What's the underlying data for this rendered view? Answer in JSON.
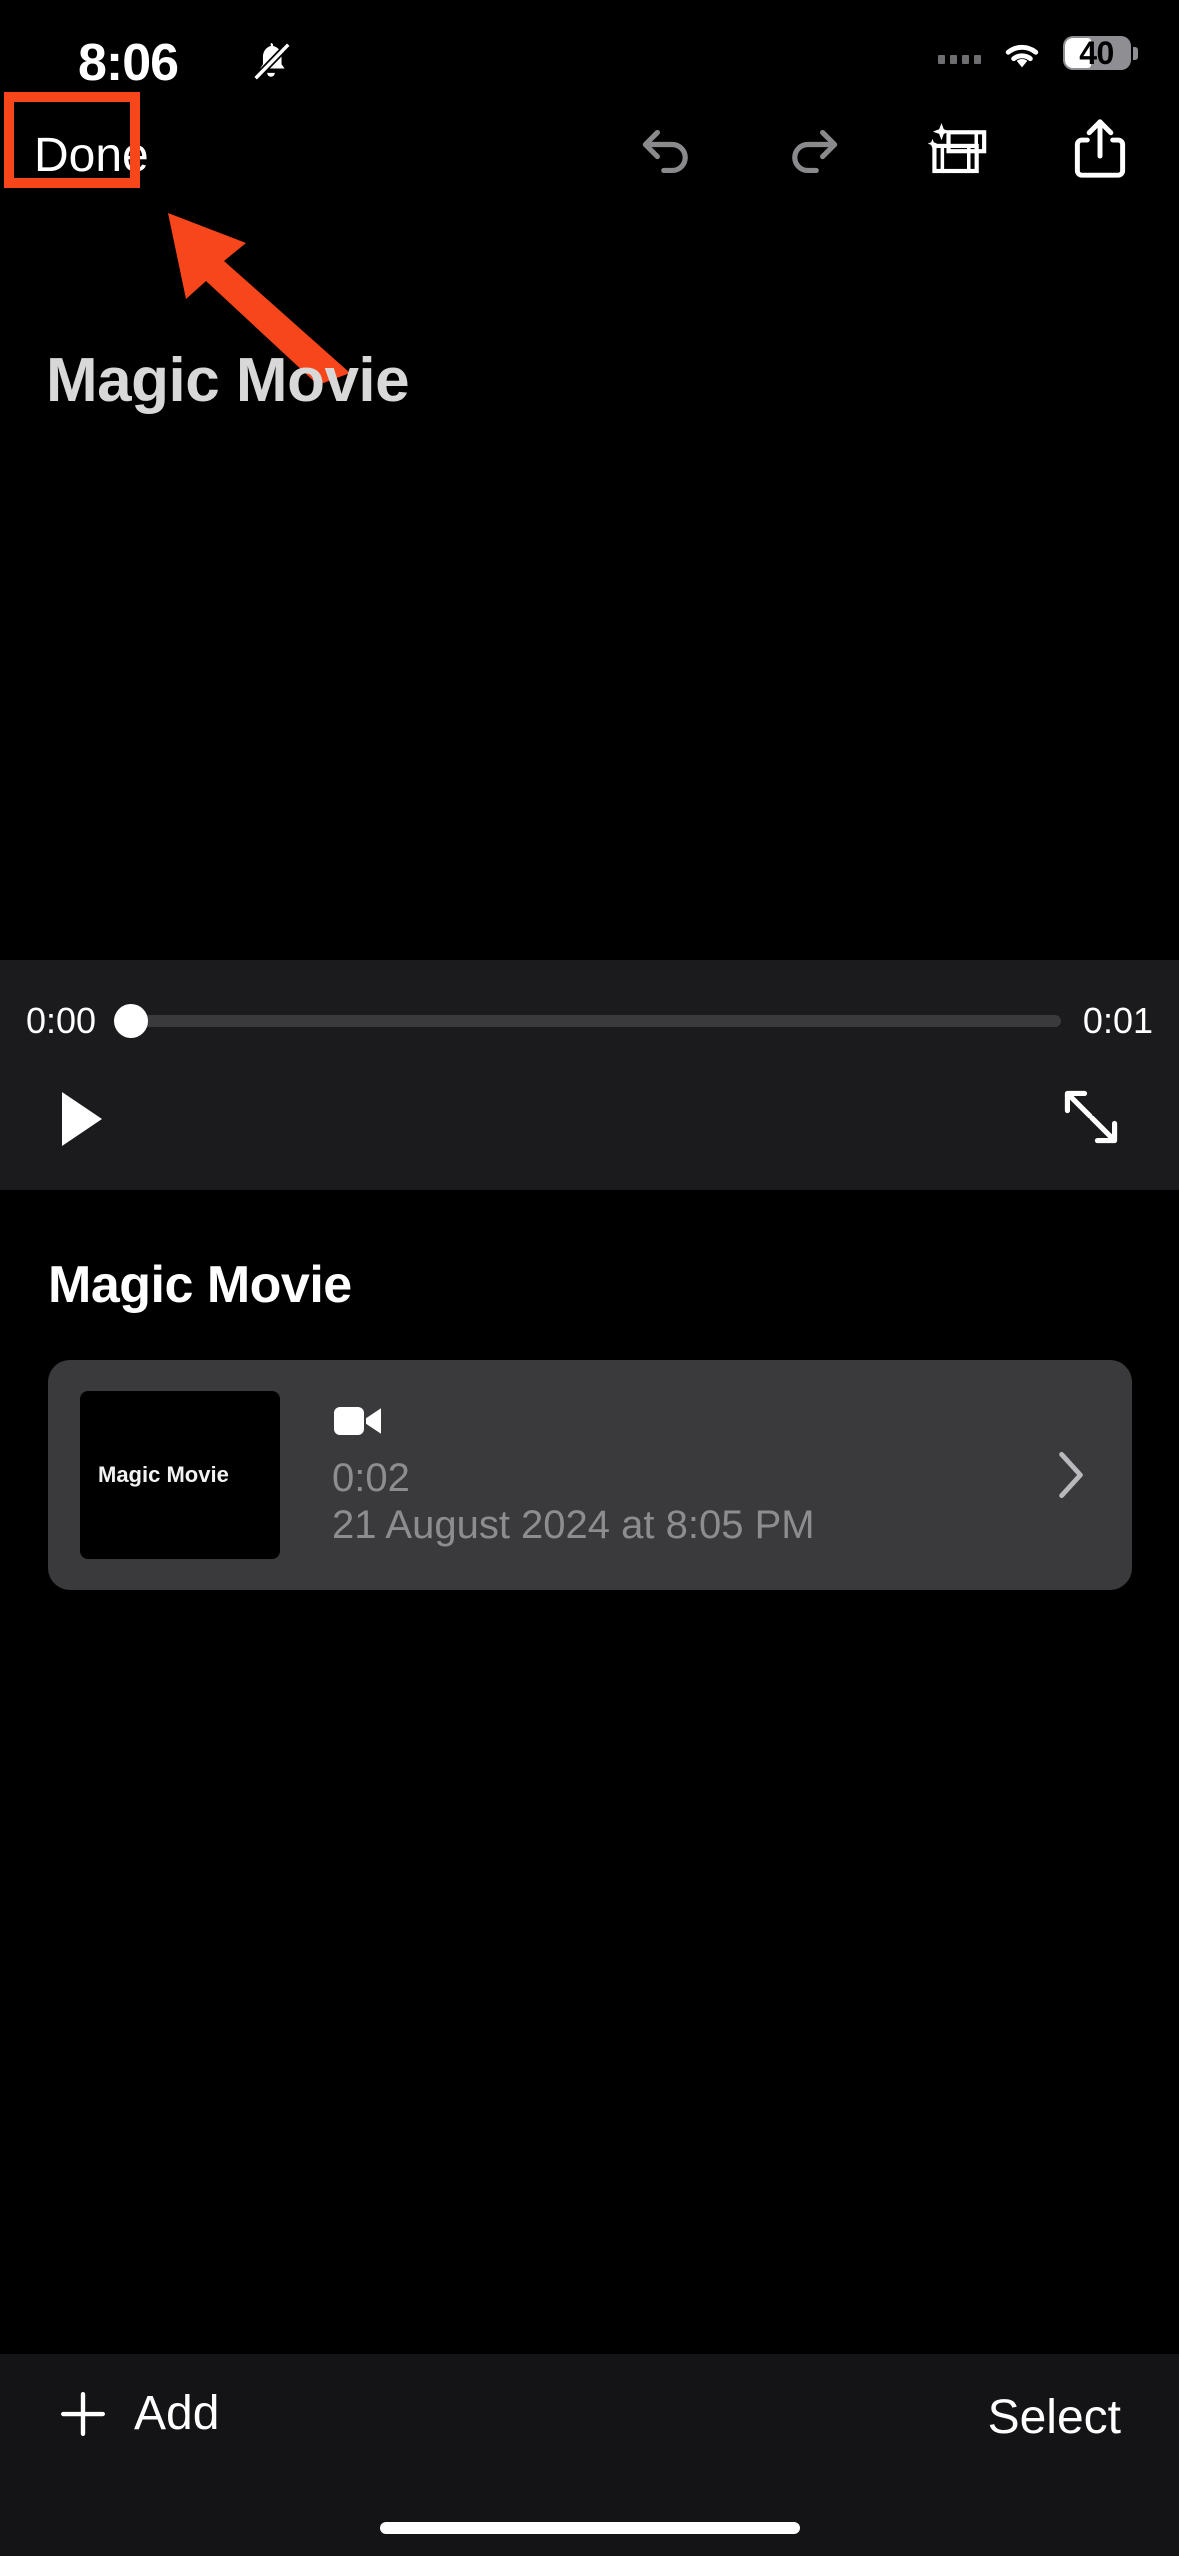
{
  "status_bar": {
    "time": "8:06",
    "silent_icon": "bell-slash-icon",
    "signal_icon": "cellular-dots-icon",
    "wifi_icon": "wifi-icon",
    "battery_level": "40"
  },
  "toolbar": {
    "done_label": "Done",
    "icons": [
      {
        "name": "undo-icon",
        "state": "dimmed"
      },
      {
        "name": "redo-icon",
        "state": "dimmed"
      },
      {
        "name": "magic-movie-icon",
        "state": "active"
      },
      {
        "name": "share-icon",
        "state": "active"
      }
    ]
  },
  "annotation": {
    "label": "Magic Movie",
    "highlight_color": "#f8461c",
    "arrow_color": "#f8461c",
    "target": "done-button"
  },
  "player": {
    "current_time": "0:00",
    "total_time": "0:01",
    "progress_percent": 0,
    "play_icon": "play-icon",
    "expand_icon": "expand-arrows-icon"
  },
  "clip_section": {
    "title": "Magic Movie",
    "items": [
      {
        "thumbnail_label": "Magic Movie",
        "type_icon": "video-camera-icon",
        "duration": "0:02",
        "date": "21 August 2024 at 8:05 PM",
        "chevron_icon": "chevron-right-icon"
      }
    ]
  },
  "bottom_bar": {
    "add_icon": "plus-icon",
    "add_label": "Add",
    "select_label": "Select"
  },
  "colors": {
    "background": "#000000",
    "panel": "#1b1b1d",
    "card": "#3a3a3c",
    "bottom_bar": "#141416",
    "muted_text": "#8d8d90",
    "accent": "#f8461c"
  }
}
